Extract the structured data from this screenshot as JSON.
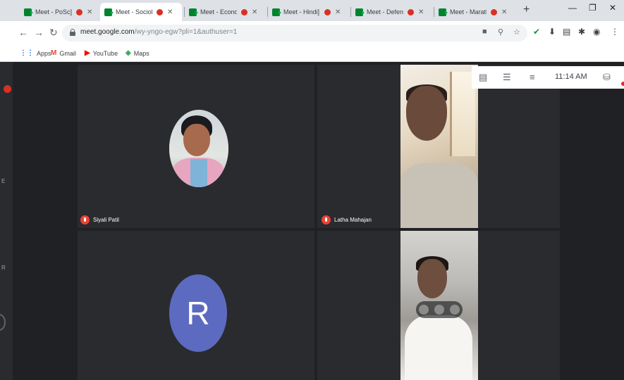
{
  "browser": {
    "tabs": [
      {
        "title": "Meet - PoSc]",
        "recording": true,
        "active": false
      },
      {
        "title": "Meet - Sociolo",
        "recording": true,
        "active": true
      },
      {
        "title": "Meet - Econo]",
        "recording": true,
        "active": false
      },
      {
        "title": "Meet - Hindi]",
        "recording": true,
        "active": false
      },
      {
        "title": "Meet - Defenc",
        "recording": true,
        "active": false
      },
      {
        "title": "Meet - Marathi",
        "recording": true,
        "active": false
      }
    ],
    "new_tab_icon": "plus-icon",
    "window_controls": [
      "minimize-icon",
      "restore-icon",
      "close-icon"
    ]
  },
  "toolbar": {
    "url_host": "meet.google.com",
    "url_path": "/wy-yngo-egw?pli=1&authuser=1",
    "extension_icons": [
      "camera-icon",
      "zoom-icon",
      "star-icon",
      "check-icon",
      "download-icon",
      "notes-icon",
      "puzzle-icon",
      "profile-icon",
      "menu-icon"
    ]
  },
  "bookmarks": [
    {
      "label": "Apps",
      "icon": "apps-grid-icon",
      "color": "#1a73e8"
    },
    {
      "label": "Gmail",
      "icon": "gmail-icon",
      "color": "#ea4335"
    },
    {
      "label": "YouTube",
      "icon": "youtube-icon",
      "color": "#ff0000"
    },
    {
      "label": "Maps",
      "icon": "maps-icon",
      "color": "#34a853"
    }
  ],
  "meet": {
    "time": "11:14 AM",
    "info_icons": [
      "present-icon",
      "chat-icon",
      "participants-icon",
      "recording-icon"
    ],
    "participants": [
      {
        "name": "Siyali Patil",
        "display": "photo"
      },
      {
        "name": "Latha Mahajan",
        "display": "camera"
      },
      {
        "name": "",
        "display": "initial",
        "initial": "R"
      },
      {
        "name": "",
        "display": "camera"
      }
    ]
  },
  "colors": {
    "meet_bg": "#202124",
    "tile_bg": "#3c4043",
    "mic_muted": "#ea4335",
    "avatar_initial_bg": "#5c6bc0",
    "recording_dot": "#d93025"
  }
}
